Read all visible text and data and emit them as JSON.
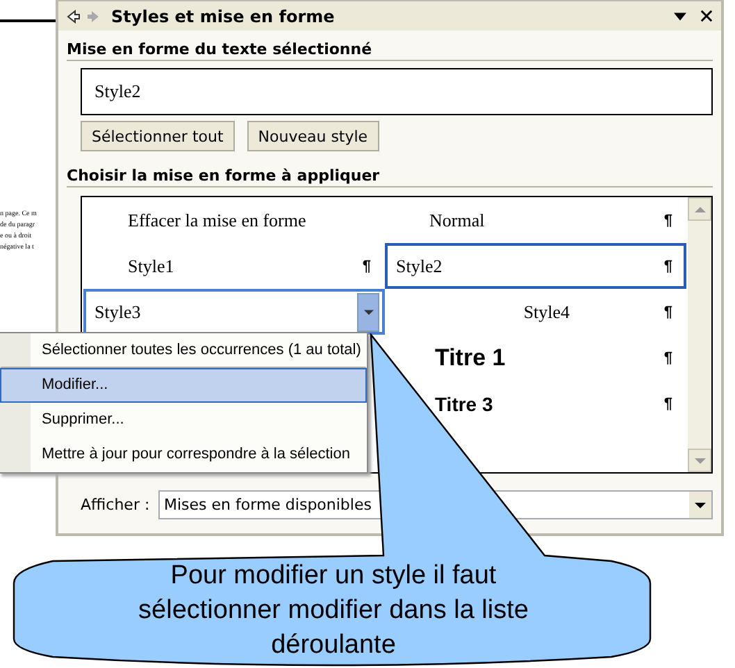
{
  "document": {
    "lines": [
      "n page. Ce m",
      "de du paragr",
      "e ou à droit",
      "négative la t"
    ]
  },
  "pane": {
    "title": "Styles et mise en forme",
    "forward_disabled": true,
    "current_section": "Mise en forme du texte sélectionné",
    "current_value": "Style2",
    "buttons": [
      "Sélectionner tout",
      "Nouveau style"
    ],
    "apply_section": "Choisir la mise en forme à appliquer",
    "styles": [
      {
        "label": "Effacer la mise en forme",
        "kind": "plain",
        "selected": false,
        "menu_open": false
      },
      {
        "label": "Normal",
        "kind": "plain",
        "mark": "¶",
        "selected": false,
        "menu_open": false
      },
      {
        "label": "Style1",
        "kind": "plain",
        "mark": "¶",
        "selected": false,
        "menu_open": false
      },
      {
        "label": "Style2",
        "kind": "plain",
        "mark": "¶",
        "selected": true,
        "menu_open": false
      },
      {
        "label": "Style3",
        "kind": "plain",
        "selected": false,
        "menu_open": true
      },
      {
        "label": "Style4",
        "kind": "centered",
        "mark": "¶",
        "selected": false,
        "menu_open": false
      },
      {
        "label": "Titre 1",
        "kind": "heading1",
        "mark": "¶",
        "selected": false,
        "menu_open": false
      },
      {
        "label": "Titre 3",
        "kind": "heading3",
        "mark": "¶",
        "selected": false,
        "menu_open": false
      }
    ],
    "show_label": "Afficher :",
    "show_value": "Mises en forme disponibles"
  },
  "context_menu": [
    {
      "label": "Sélectionner toutes les occurrences (1 au total)",
      "selected": false
    },
    {
      "label": "Modifier...",
      "selected": true
    },
    {
      "label": "Supprimer...",
      "selected": false
    },
    {
      "label": "Mettre à jour pour correspondre à la sélection",
      "selected": false
    }
  ],
  "callout": {
    "text": "Pour modifier un style il faut sélectionner modifier dans la liste déroulante"
  }
}
